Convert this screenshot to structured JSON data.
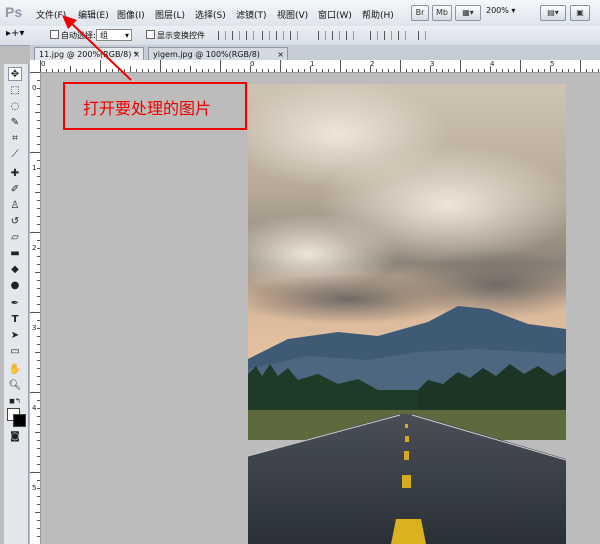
{
  "app": {
    "logo": "Ps"
  },
  "menu": [
    {
      "label": "文件(F)"
    },
    {
      "label": "编辑(E)"
    },
    {
      "label": "图像(I)"
    },
    {
      "label": "图层(L)"
    },
    {
      "label": "选择(S)"
    },
    {
      "label": "滤镜(T)"
    },
    {
      "label": "视图(V)"
    },
    {
      "label": "窗口(W)"
    },
    {
      "label": "帮助(H)"
    }
  ],
  "toolbar_right": {
    "br_label": "Br",
    "mb_label": "Mb",
    "zoom": "200%"
  },
  "options": {
    "auto_select_label": "自动选择:",
    "group_value": "组",
    "show_transform_label": "显示变换控件"
  },
  "tabs": [
    {
      "label": "11.jpg @ 200%(RGB/8) *",
      "close": "×"
    },
    {
      "label": "yigem.jpg @ 100%(RGB/8)",
      "close": "×"
    }
  ],
  "ruler": {
    "top_labels": [
      "0",
      "0",
      "1",
      "2",
      "3",
      "4",
      "5",
      "6"
    ],
    "left_labels": [
      "0",
      "1",
      "2",
      "3",
      "4",
      "5"
    ]
  },
  "annotation": {
    "text": "打开要处理的图片",
    "color": "#ee0000"
  },
  "colors": {
    "accent_red": "#ee0000",
    "workspace": "#bcbcbc"
  }
}
